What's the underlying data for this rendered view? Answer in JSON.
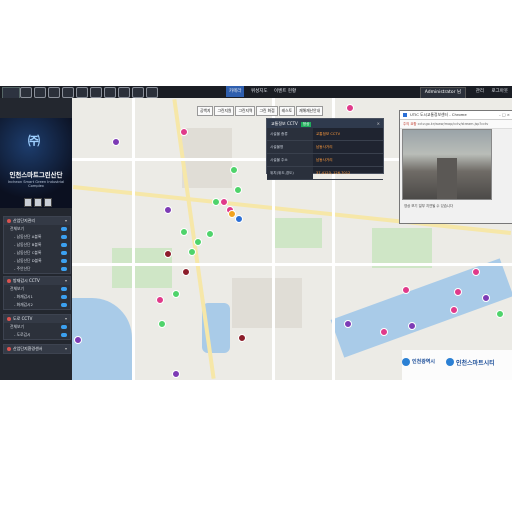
{
  "topbar": {
    "tabs": [
      "카메라",
      "위성지도",
      "이벤트 현황"
    ],
    "user": "Administrator 님",
    "buttons": [
      "관리",
      "로그아웃"
    ]
  },
  "sidebar": {
    "brand_title": "인천스마트그린산단",
    "brand_subtitle": "Incheon Smart Green Industrial Complex",
    "sections": [
      {
        "title": "산업단지관리",
        "rows": [
          "전체보기",
          "- 남동산단 A블록",
          "- 남동산단 B블록",
          "- 남동산단 C블록",
          "- 남동산단 D블록",
          "- 주안산단"
        ]
      },
      {
        "title": "방재감시 CCTV",
        "rows": [
          "전체보기",
          "- 화재감시1",
          "- 화재감시2"
        ]
      },
      {
        "title": "도로 CCTV",
        "rows": [
          "전체보기",
          "- 도로감시"
        ]
      },
      {
        "title": "산업단지환경센서",
        "rows": []
      }
    ]
  },
  "map": {
    "tabs": [
      "공백지",
      "그린지원",
      "그린지역",
      "그린 화점",
      "레스토",
      "재해재난안내"
    ]
  },
  "info_panel": {
    "title": "교통정보 CCTV",
    "badge": "정상",
    "rows": [
      {
        "key": "시설물 종류",
        "value": "교통정보 CCTV"
      },
      {
        "key": "시설물명",
        "value": "남동사거리"
      },
      {
        "key": "시설물 주소",
        "value": "남동사거리"
      },
      {
        "key": "위치(위도,경도)",
        "value": "37.4123, 126.7012"
      }
    ]
  },
  "popup": {
    "title": "UTIC 도시교통정보센터 - Chrome",
    "address_label": "주의 요함",
    "address": "cctv.go.kr/www/map/cctv/stream.jsp?cctv",
    "caption": "영상 보기 일부 지연될 수 있습니다"
  },
  "logos": {
    "left": "인천광역시",
    "right": "인천스마트시티"
  }
}
